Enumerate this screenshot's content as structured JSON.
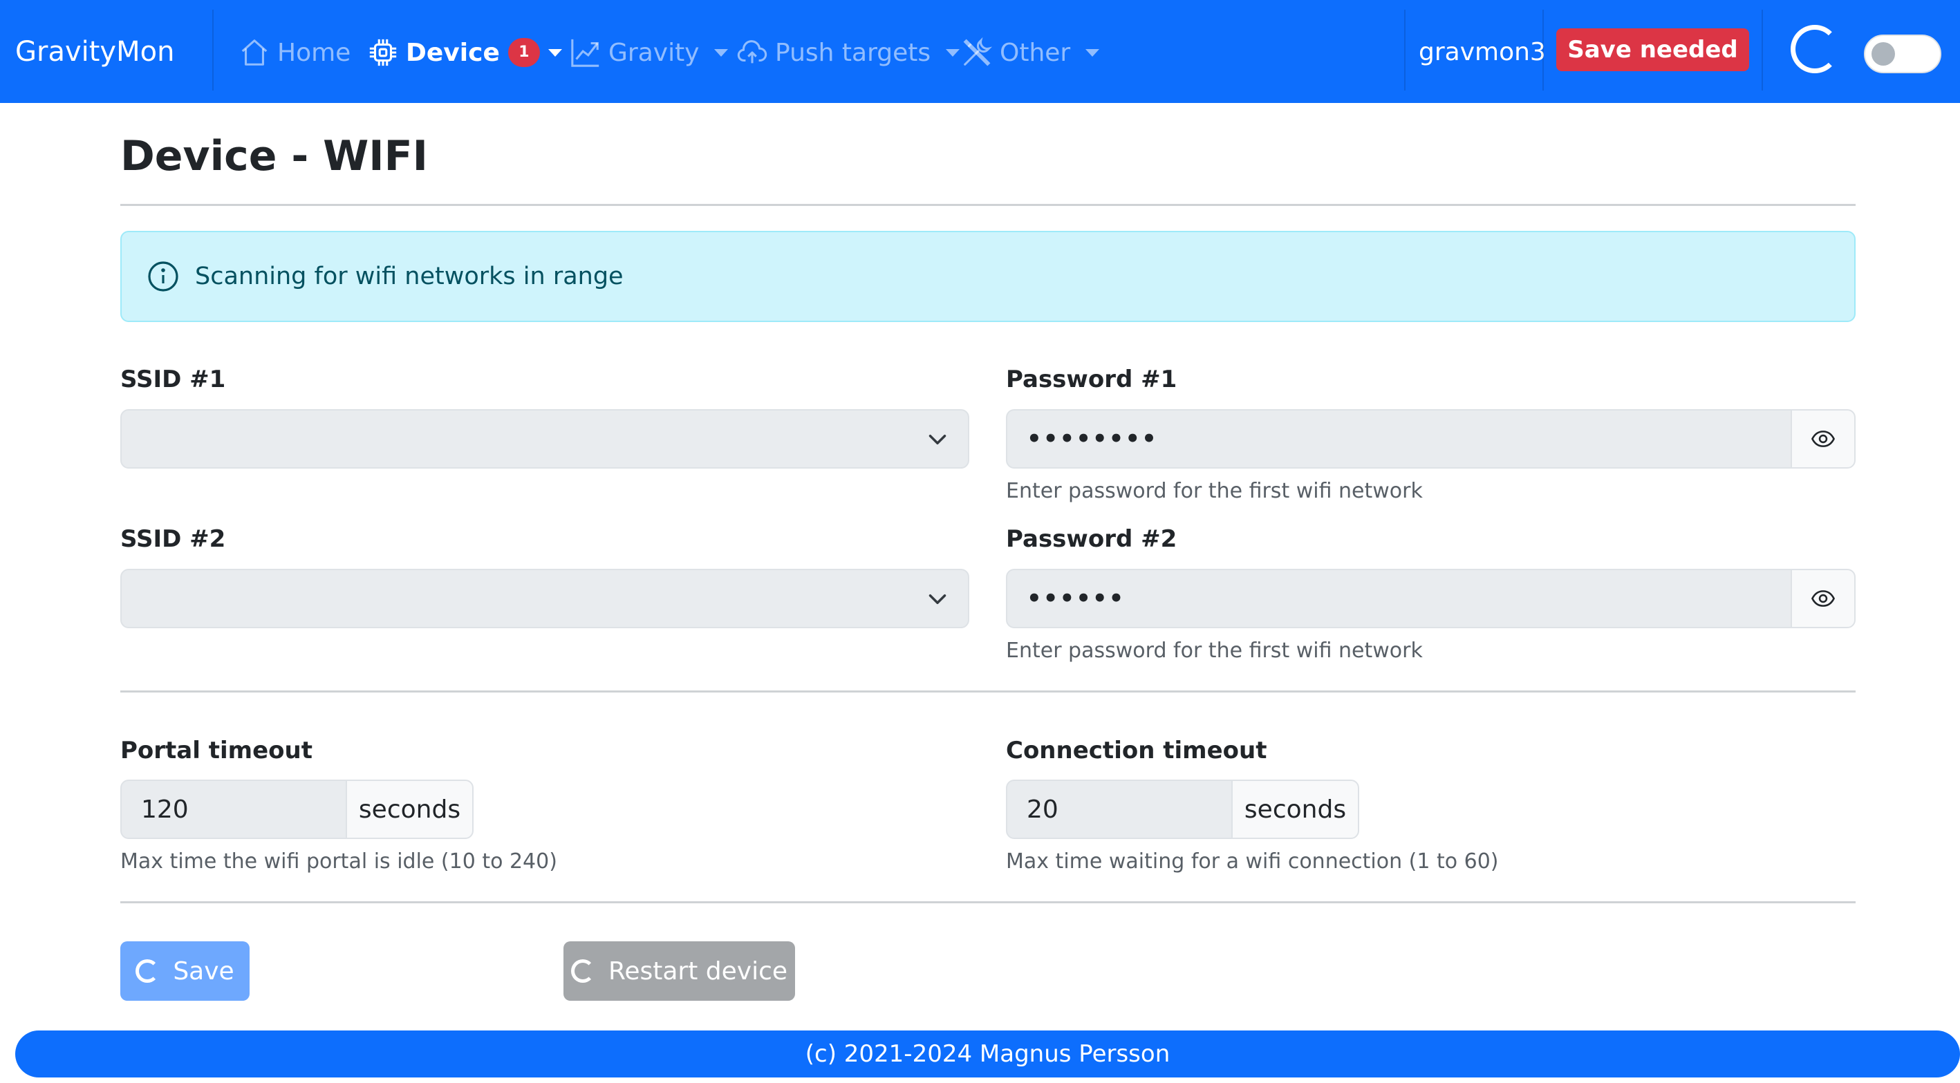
{
  "navbar": {
    "brand": "GravityMon",
    "items": [
      {
        "label": "Home",
        "icon": "house-icon",
        "active": false,
        "dropdown": false
      },
      {
        "label": "Device",
        "icon": "cpu-icon",
        "active": true,
        "dropdown": true,
        "badge": "1"
      },
      {
        "label": "Gravity",
        "icon": "graph-up-icon",
        "active": false,
        "dropdown": true
      },
      {
        "label": "Push targets",
        "icon": "cloud-upload-icon",
        "active": false,
        "dropdown": true
      },
      {
        "label": "Other",
        "icon": "tools-icon",
        "active": false,
        "dropdown": true
      }
    ],
    "hostname": "gravmon3",
    "save_needed": "Save needed",
    "dark_mode_toggle": false
  },
  "page": {
    "title": "Device - WIFI"
  },
  "alert": {
    "text": "Scanning for wifi networks in range",
    "icon": "info-circle-icon"
  },
  "form": {
    "ssid1": {
      "label": "SSID #1",
      "value": ""
    },
    "ssid2": {
      "label": "SSID #2",
      "value": ""
    },
    "password1": {
      "label": "Password #1",
      "masked_value": "••••••••",
      "help": "Enter password for the first wifi network"
    },
    "password2": {
      "label": "Password #2",
      "masked_value": "••••••",
      "help": "Enter password for the first wifi network"
    },
    "portal_timeout": {
      "label": "Portal timeout",
      "value": "120",
      "unit": "seconds",
      "help": "Max time the wifi portal is idle (10 to 240)"
    },
    "connection_timeout": {
      "label": "Connection timeout",
      "value": "20",
      "unit": "seconds",
      "help": "Max time waiting for a wifi connection (1 to 60)"
    }
  },
  "actions": {
    "save_label": "Save",
    "restart_label": "Restart device"
  },
  "footer": {
    "text": "(c) 2021-2024 Magnus Persson"
  },
  "colors": {
    "primary": "#0d6efd",
    "danger": "#dc3545",
    "info_bg": "#cff4fc",
    "info_text": "#055160",
    "secondary": "#a3a6a9"
  }
}
